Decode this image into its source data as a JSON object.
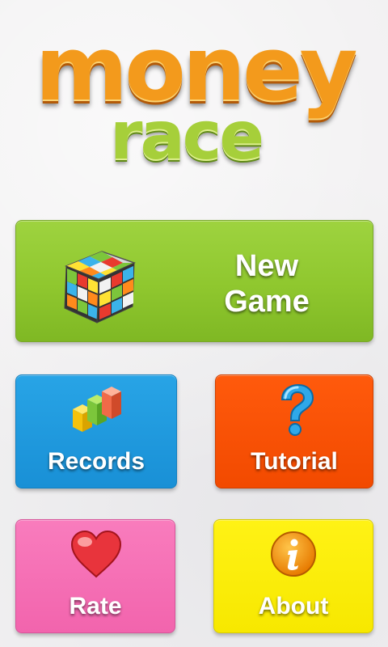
{
  "logo": {
    "word1": "money",
    "word2": "race"
  },
  "menu": {
    "new_game": "New Game",
    "records": "Records",
    "tutorial": "Tutorial",
    "rate": "Rate",
    "about": "About"
  },
  "icons": {
    "new_game": "rubiks-cube-icon",
    "records": "bar-chart-blocks-icon",
    "tutorial": "question-mark-icon",
    "rate": "heart-icon",
    "about": "info-icon"
  },
  "colors": {
    "background": "#f1f0f1",
    "logo_orange": "#f39a1c",
    "logo_green": "#a6cf3a",
    "new_game": "#8fc72e",
    "records": "#1b94d9",
    "tutorial": "#f54c00",
    "rate": "#f46fb4",
    "about": "#fbee00"
  }
}
